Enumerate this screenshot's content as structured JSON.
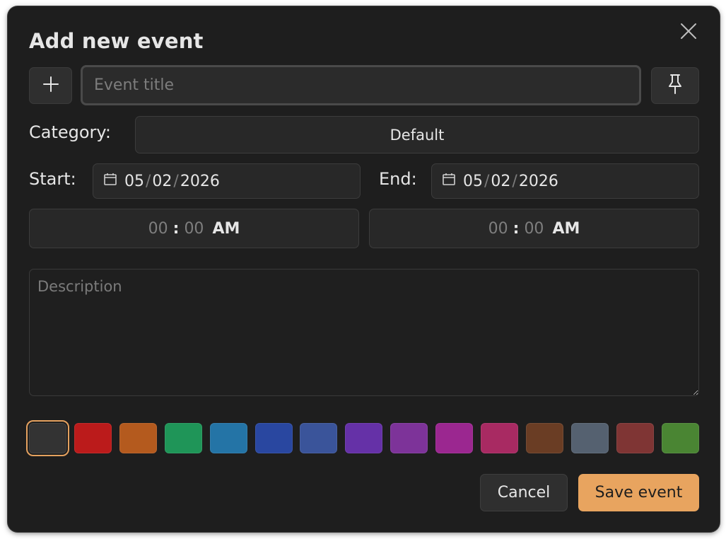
{
  "dialog": {
    "title": "Add new event",
    "close_icon": "close-icon"
  },
  "title_row": {
    "add_icon": "plus-icon",
    "title_placeholder": "Event title",
    "title_value": "",
    "pin_icon": "pin-icon"
  },
  "category": {
    "label": "Category:",
    "value": "Default"
  },
  "start": {
    "label": "Start:",
    "date": {
      "month": "05",
      "day": "02",
      "year": "2026",
      "separator": "/"
    },
    "time": {
      "hours": "00",
      "minutes": "00",
      "separator": ":",
      "period": "AM"
    }
  },
  "end": {
    "label": "End:",
    "date": {
      "month": "05",
      "day": "02",
      "year": "2026",
      "separator": "/"
    },
    "time": {
      "hours": "00",
      "minutes": "00",
      "separator": ":",
      "period": "AM"
    }
  },
  "description": {
    "placeholder": "Description",
    "value": ""
  },
  "colors": {
    "selected_index": 0,
    "selected_outline": "#e4a15f",
    "swatches": [
      "#333333",
      "#bb1b1b",
      "#b45a1e",
      "#1f9558",
      "#2474a6",
      "#2947a0",
      "#3a549a",
      "#6531a7",
      "#7d3399",
      "#9b2790",
      "#a82a62",
      "#6a3d24",
      "#556170",
      "#7f3534",
      "#4a8533"
    ]
  },
  "actions": {
    "cancel_label": "Cancel",
    "save_label": "Save event",
    "save_color": "#e8a45f"
  }
}
